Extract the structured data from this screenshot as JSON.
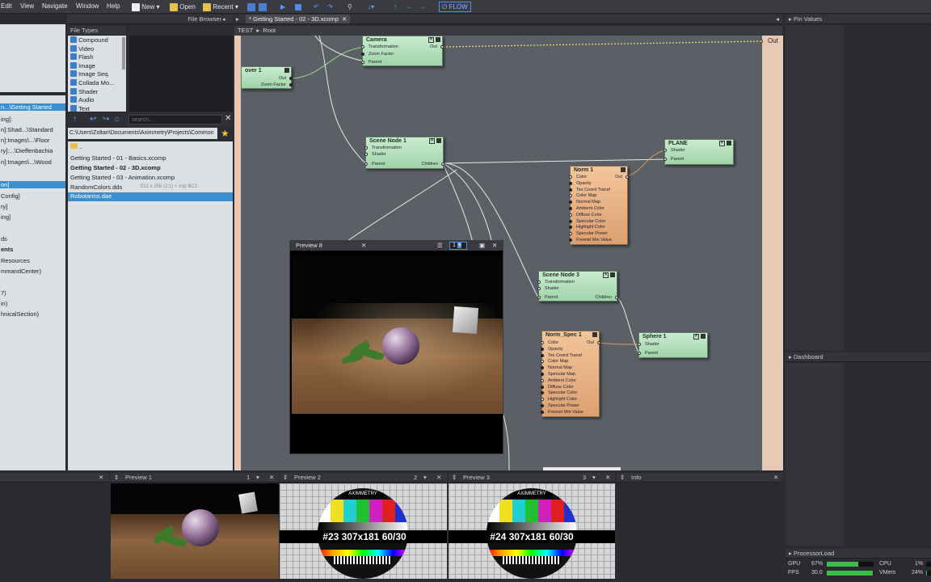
{
  "menu": {
    "items": [
      "Edit",
      "View",
      "Navigate",
      "Window",
      "Help"
    ],
    "new": "New",
    "open": "Open",
    "recent": "Recent",
    "flow": "FLOW"
  },
  "file_browser": {
    "title": "File Browser",
    "file_types_title": "File Types",
    "file_types": [
      "Compound",
      "Video",
      "Flash",
      "Image",
      "Image Seq.",
      "Collada Mo...",
      "Shader",
      "Audio",
      "Text"
    ],
    "search_placeholder": "search...",
    "path": "C:\\Users\\Zoltan\\Documents\\Aximmetry\\Projects\\Common",
    "files": [
      "..",
      "Getting Started - 01 - Basics.xcomp",
      "Getting Started - 02 - 3D.xcomp",
      "Getting Started - 03 - Animation.xcomp",
      "RandomColors.dds",
      "Robotarms.dae"
    ],
    "file_meta": "512 x 256 (2:1) + mip  BC1"
  },
  "left": {
    "items": [
      "n...\\Getting Started",
      "ing]:",
      "n]:Shad...\\Standard",
      "n]:Images\\...\\Floor",
      "ry]:...\\Dieffenbachia",
      "n]:Images\\...\\Wood",
      "on]",
      "Config]",
      "ry]",
      "ing]",
      "ds",
      "ents",
      "Resources",
      "mmandCenter)",
      "7)",
      "in)",
      "hnicalSection)"
    ]
  },
  "editor": {
    "tab": "* Getting Started - 02 - 3D.xcomp",
    "crumbs": [
      "TEST",
      "Root"
    ],
    "out_label": "Out"
  },
  "nodes": {
    "camera": {
      "title": "Camera",
      "ports": [
        "Transformation",
        "Zoom Factor",
        "Parent"
      ],
      "out": "Out"
    },
    "mover": {
      "title": "over 1",
      "ports": [
        "Out",
        "Zoom Factor"
      ]
    },
    "scene1": {
      "title": "Scene Node 1",
      "ports": [
        "Transformation",
        "Shader",
        "Parent"
      ],
      "out": "Children"
    },
    "plane": {
      "title": "PLANE",
      "ports": [
        "Shader",
        "Parent"
      ]
    },
    "norm1": {
      "title": "Norm 1",
      "out": "Out",
      "ports": [
        "Color",
        "Opacity",
        "Tex Coord Transf",
        "Color Map",
        "Normal Map",
        "Ambient Color",
        "Diffuse Color",
        "Specular Color",
        "Highlight Color",
        "Specular Power",
        "Fresnel Min Value"
      ]
    },
    "scene3": {
      "title": "Scene Node 3",
      "ports": [
        "Transformation",
        "Shader",
        "Parent"
      ],
      "out": "Children"
    },
    "normspec": {
      "title": "Norm_Spec 1",
      "out": "Out",
      "ports": [
        "Color",
        "Opacity",
        "Tex Coord Transf",
        "Color Map",
        "Normal Map",
        "Specular Map",
        "Ambient Color",
        "Diffuse Color",
        "Specular Color",
        "Highlight Color",
        "Specular Power",
        "Fresnel Min Value"
      ]
    },
    "sphere": {
      "title": "Sphere 1",
      "ports": [
        "Shader",
        "Parent"
      ]
    }
  },
  "preview8": {
    "title": "Preview 8",
    "channel": "1"
  },
  "right": {
    "pin_values": "Pin Values",
    "dashboard": "Dashboard",
    "processor_load": "ProcessorLoad",
    "gpu_label": "GPU",
    "gpu_val": "67%",
    "gpu_level": 0.67,
    "fps_label": "FPS",
    "fps_val": "30.0",
    "fps_level": 0.99,
    "cpu_label": "CPU",
    "cpu_val": "1%",
    "cpu_level": 0.01,
    "vmem_label": "VMem",
    "vmem_val": "24%",
    "vmem_level": 0.24
  },
  "bottom": {
    "preview1": "Preview 1",
    "p1_num": "1",
    "preview2": "Preview 2",
    "p2_num": "2",
    "preview3": "Preview 3",
    "p3_num": "3",
    "info": "Info",
    "brand": "AXIMMETRY",
    "tc2": "#23 307x181 60/30",
    "tc3": "#24 307x181 60/30"
  },
  "colors": {
    "accent": "#3a8fd0",
    "node_green": "#b4e2bb",
    "node_orange": "#e8b283",
    "link": "#f0e070"
  }
}
